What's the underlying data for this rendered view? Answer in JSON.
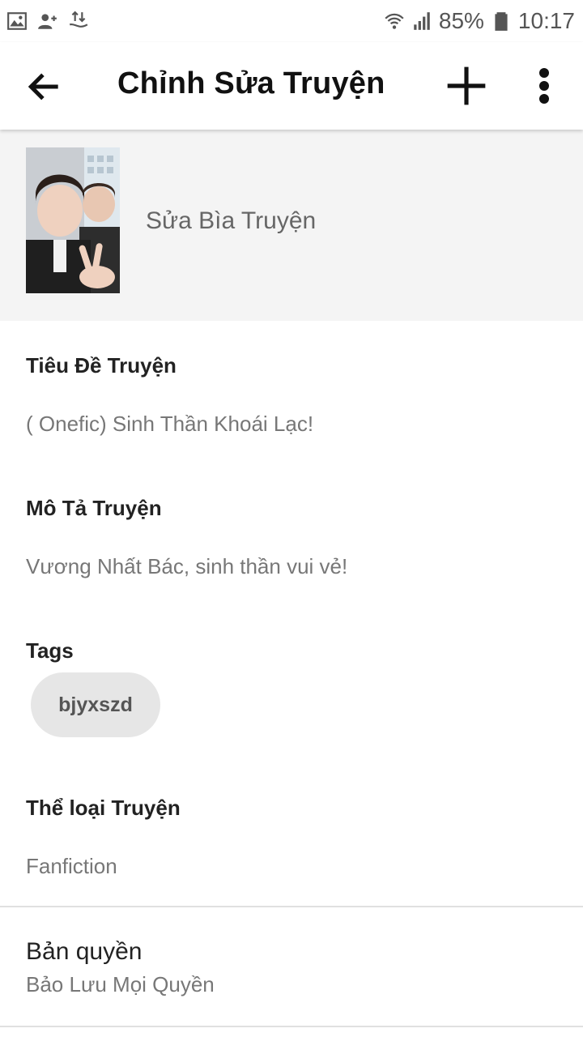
{
  "status_bar": {
    "battery": "85%",
    "time": "10:17",
    "icons": [
      "image-icon",
      "add-contact-icon",
      "transfer-icon",
      "wifi-icon",
      "signal-icon",
      "battery-icon"
    ]
  },
  "app_bar": {
    "title": "Chỉnh Sửa Truyện",
    "icons": [
      "back-arrow-icon",
      "plus-icon",
      "more-vert-icon"
    ]
  },
  "cover": {
    "label": "Sửa Bìa Truyện"
  },
  "fields": {
    "title_label": "Tiêu Đề Truyện",
    "title_value": "( Onefic) Sinh Thần Khoái Lạc!",
    "description_label": "Mô Tả Truyện",
    "description_value": "Vương Nhất Bác, sinh thần vui vẻ!",
    "tags_label": "Tags",
    "tags": [
      "bjyxszd"
    ],
    "genre_label": "Thể loại Truyện",
    "genre_value": "Fanfiction",
    "copyright_label": "Bản quyền",
    "copyright_value": "Bảo Lưu Mọi Quyền"
  },
  "colors": {
    "cover_bg": "#f4f4f4",
    "chip_bg": "#e6e6e6",
    "secondary_text": "#777777"
  }
}
